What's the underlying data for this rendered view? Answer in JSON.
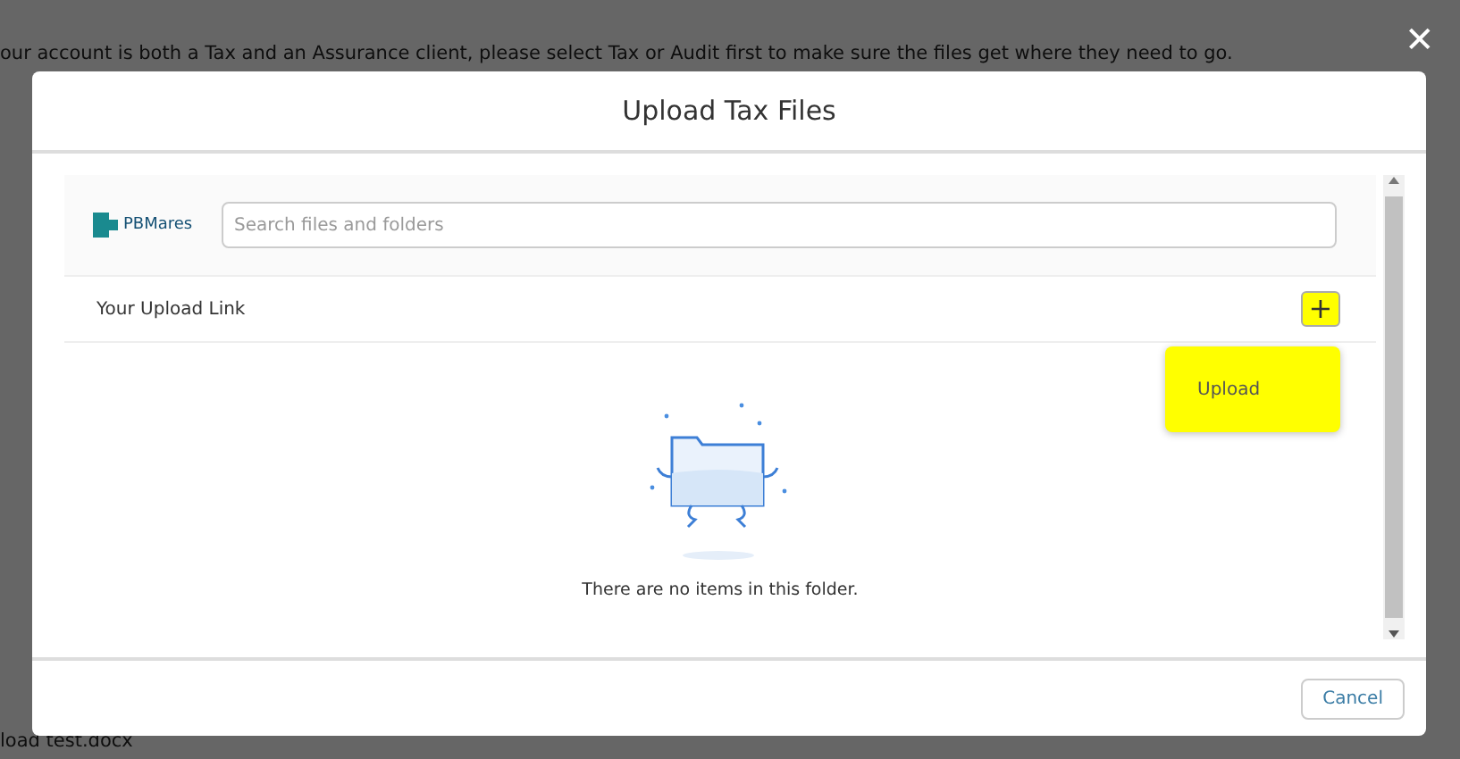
{
  "background_page": {
    "lines": [
      "our account is both a Tax and an Assurance client, please select Tax or Audit first to make sure the files get where they need to go."
    ],
    "footer_text": "load test.docx"
  },
  "close_label": "✕",
  "dialog": {
    "title": "Upload Tax Files",
    "logo_text": "PBMares",
    "search": {
      "placeholder": "Search files and folders"
    },
    "folder_name": "Your Upload Link",
    "add_button": {
      "label": "+",
      "highlighted": true
    },
    "menu": [
      {
        "label": "Upload",
        "highlighted": true
      }
    ],
    "empty_message": "There are no items in this folder.",
    "buttons": [
      {
        "label": "Cancel"
      }
    ]
  }
}
